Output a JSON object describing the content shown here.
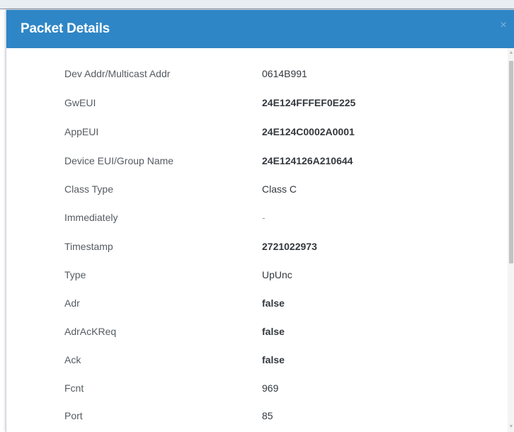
{
  "modal": {
    "title": "Packet Details",
    "close_icon": "close-icon",
    "close_glyph": "×"
  },
  "details": [
    {
      "label": "Dev Addr/Multicast Addr",
      "value": "0614B991"
    },
    {
      "label": "GwEUI",
      "value": "24E124FFFEF0E225"
    },
    {
      "label": "AppEUI",
      "value": "24E124C0002A0001"
    },
    {
      "label": "Device EUI/Group Name",
      "value": "24E124126A210644"
    },
    {
      "label": "Class Type",
      "value": "Class C"
    },
    {
      "label": "Immediately",
      "value": "-"
    },
    {
      "label": "Timestamp",
      "value": "2721022973"
    },
    {
      "label": "Type",
      "value": "UpUnc"
    },
    {
      "label": "Adr",
      "value": "false"
    },
    {
      "label": "AdrAcKReq",
      "value": "false"
    },
    {
      "label": "Ack",
      "value": "false"
    },
    {
      "label": "Fcnt",
      "value": "969"
    },
    {
      "label": "Port",
      "value": "85"
    }
  ],
  "scrollbar": {
    "up_glyph": "▲",
    "down_glyph": "▼"
  },
  "colors": {
    "header": "#2f86c6",
    "label": "#555b61",
    "value": "#33383d"
  }
}
